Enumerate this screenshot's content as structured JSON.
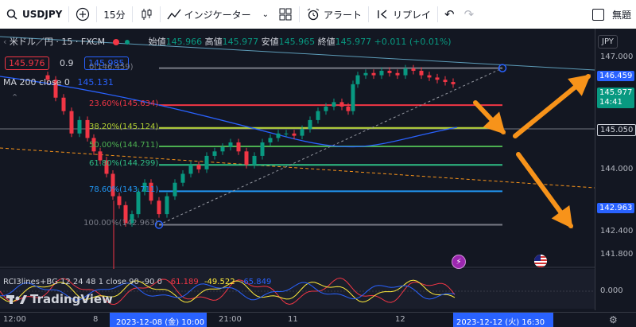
{
  "toolbar": {
    "symbol": "USDJPY",
    "interval": "15分",
    "indicators": "インジケーター",
    "alert": "アラート",
    "replay": "リプレイ",
    "layout_name": "無題"
  },
  "legend": {
    "title": "米ドル／円 · 15 · FXCM",
    "open_label": "始値",
    "open_value": "145.966",
    "high_label": "高値",
    "high_value": "145.977",
    "low_label": "安値",
    "low_value": "145.965",
    "close_label": "終値",
    "close_value": "145.977",
    "change": "+0.011 (+0.01%)",
    "sell_price": "145.976",
    "spread": "0.9",
    "buy_price": "145.985",
    "ma_label": "MA 200 close 0",
    "ma_value": "145.131"
  },
  "fib_levels": [
    {
      "label": "0(146.459)",
      "price": 146.459,
      "color": "#787b86"
    },
    {
      "label": "23.60%(145.634)",
      "price": 145.634,
      "color": "#f23645"
    },
    {
      "label": "38.20%(145.124)",
      "price": 145.124,
      "color": "#b5d334"
    },
    {
      "label": "50.00%(144.711)",
      "price": 144.711,
      "color": "#4caf50"
    },
    {
      "label": "61.80%(144.299)",
      "price": 144.299,
      "color": "#2ebd85"
    },
    {
      "label": "78.60%(143.711)",
      "price": 143.711,
      "color": "#2196f3"
    },
    {
      "label": "100.00%(142.963)",
      "price": 142.963,
      "color": "#787b86"
    }
  ],
  "price_axis": {
    "currency": "JPY",
    "ticks": [
      "147.000",
      "144.000",
      "142.400",
      "141.800"
    ],
    "markers": [
      {
        "value": "146.459",
        "bg": "#2962ff",
        "fg": "#ffffff"
      },
      {
        "value": "145.977",
        "bg": "#089981",
        "fg": "#ffffff",
        "sub": "14:41"
      },
      {
        "value": "145.050",
        "bg": "#131722",
        "fg": "#d1d4dc"
      },
      {
        "value": "142.963",
        "bg": "#2962ff",
        "fg": "#ffffff"
      }
    ],
    "osc_tick": "0.000"
  },
  "oscillator": {
    "label": "RCI3lines+BG 12 24 48 1 close 90 -90 0",
    "v1": "-61.189",
    "v2": "-49.522",
    "v3": "-65.849",
    "watermark": "TradingView"
  },
  "time_axis": {
    "labels": [
      "12:00",
      "8",
      "21:00",
      "11",
      "12"
    ],
    "highlight_start": "2023-12-08 (金)  10:00",
    "highlight_end": "2023-12-12 (火)  16:30"
  },
  "colors": {
    "bg": "#131722",
    "up": "#089981",
    "down": "#f23645",
    "ma": "#2962ff",
    "arrow": "#f7931a"
  }
}
